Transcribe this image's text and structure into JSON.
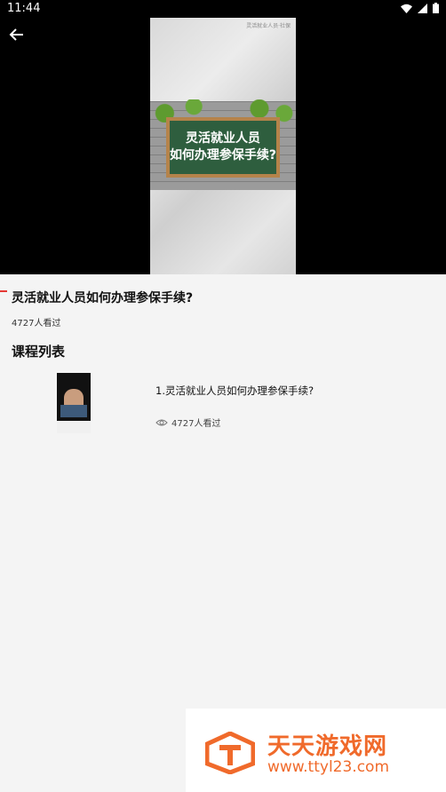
{
  "status_bar": {
    "time": "11:44"
  },
  "video": {
    "board_line1": "灵活就业人员",
    "board_line2": "如何办理参保手续?",
    "watermark": "灵活就业人员·社保"
  },
  "course": {
    "title": "灵活就业人员如何办理参保手续?",
    "views": "4727人看过"
  },
  "course_list": {
    "heading": "课程列表",
    "items": [
      {
        "name": "1.灵活就业人员如何办理参保手续?",
        "views": "4727人看过"
      }
    ]
  },
  "watermark": {
    "title": "天天游戏网",
    "url": "www.ttyl23.com"
  },
  "colors": {
    "accent": "#e53935",
    "watermark": "#f06a2b",
    "background": "#f4f4f4"
  },
  "icons": {
    "back": "arrow-left-icon",
    "views": "eye-icon",
    "wifi": "wifi-icon",
    "signal": "signal-icon",
    "battery": "battery-icon"
  }
}
